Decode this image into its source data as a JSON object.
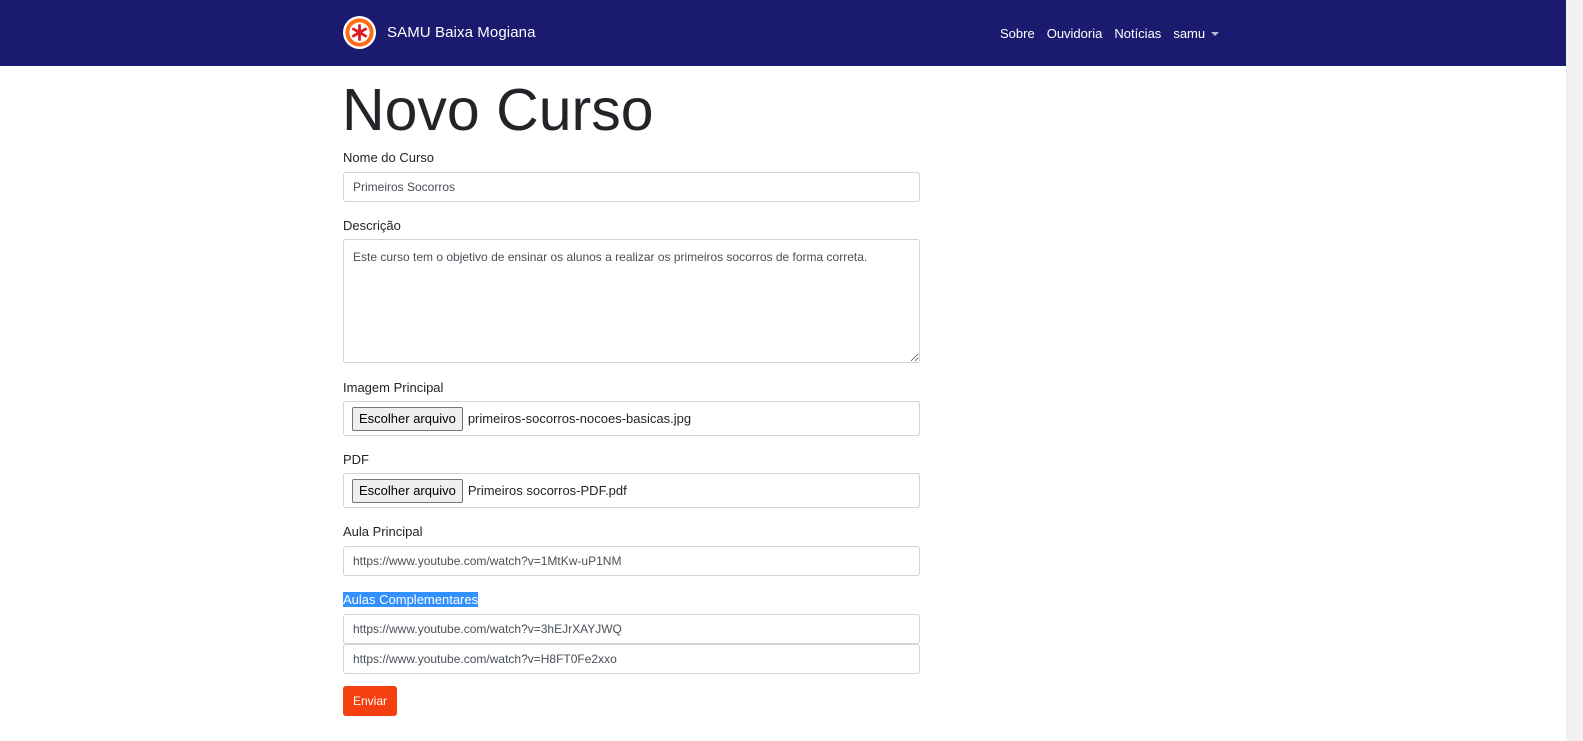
{
  "navbar": {
    "brand": "SAMU Baixa Mogiana",
    "logo_icon": "star-of-life-icon",
    "links": [
      "Sobre",
      "Ouvidoria",
      "Notícias"
    ],
    "user_menu": "samu",
    "background_color": "#1a1a6e"
  },
  "page": {
    "title": "Novo Curso"
  },
  "form": {
    "course_name": {
      "label": "Nome do Curso",
      "value": "Primeiros Socorros"
    },
    "description": {
      "label": "Descrição",
      "value": "Este curso tem o objetivo de ensinar os alunos a realizar os primeiros socorros de forma correta."
    },
    "main_image": {
      "label": "Imagem Principal",
      "button": "Escolher arquivo",
      "file_name": "primeiros-socorros-nocoes-basicas.jpg"
    },
    "pdf": {
      "label": "PDF",
      "button": "Escolher arquivo",
      "file_name": "Primeiros socorros-PDF.pdf"
    },
    "main_lesson": {
      "label": "Aula Principal",
      "value": "https://www.youtube.com/watch?v=1MtKw-uP1NM"
    },
    "extra_lessons": {
      "label": "Aulas Complementares",
      "values": [
        "https://www.youtube.com/watch?v=3hEJrXAYJWQ",
        "https://www.youtube.com/watch?v=H8FT0Fe2xxo"
      ]
    },
    "submit": {
      "label": "Enviar",
      "color": "#f44010"
    }
  }
}
